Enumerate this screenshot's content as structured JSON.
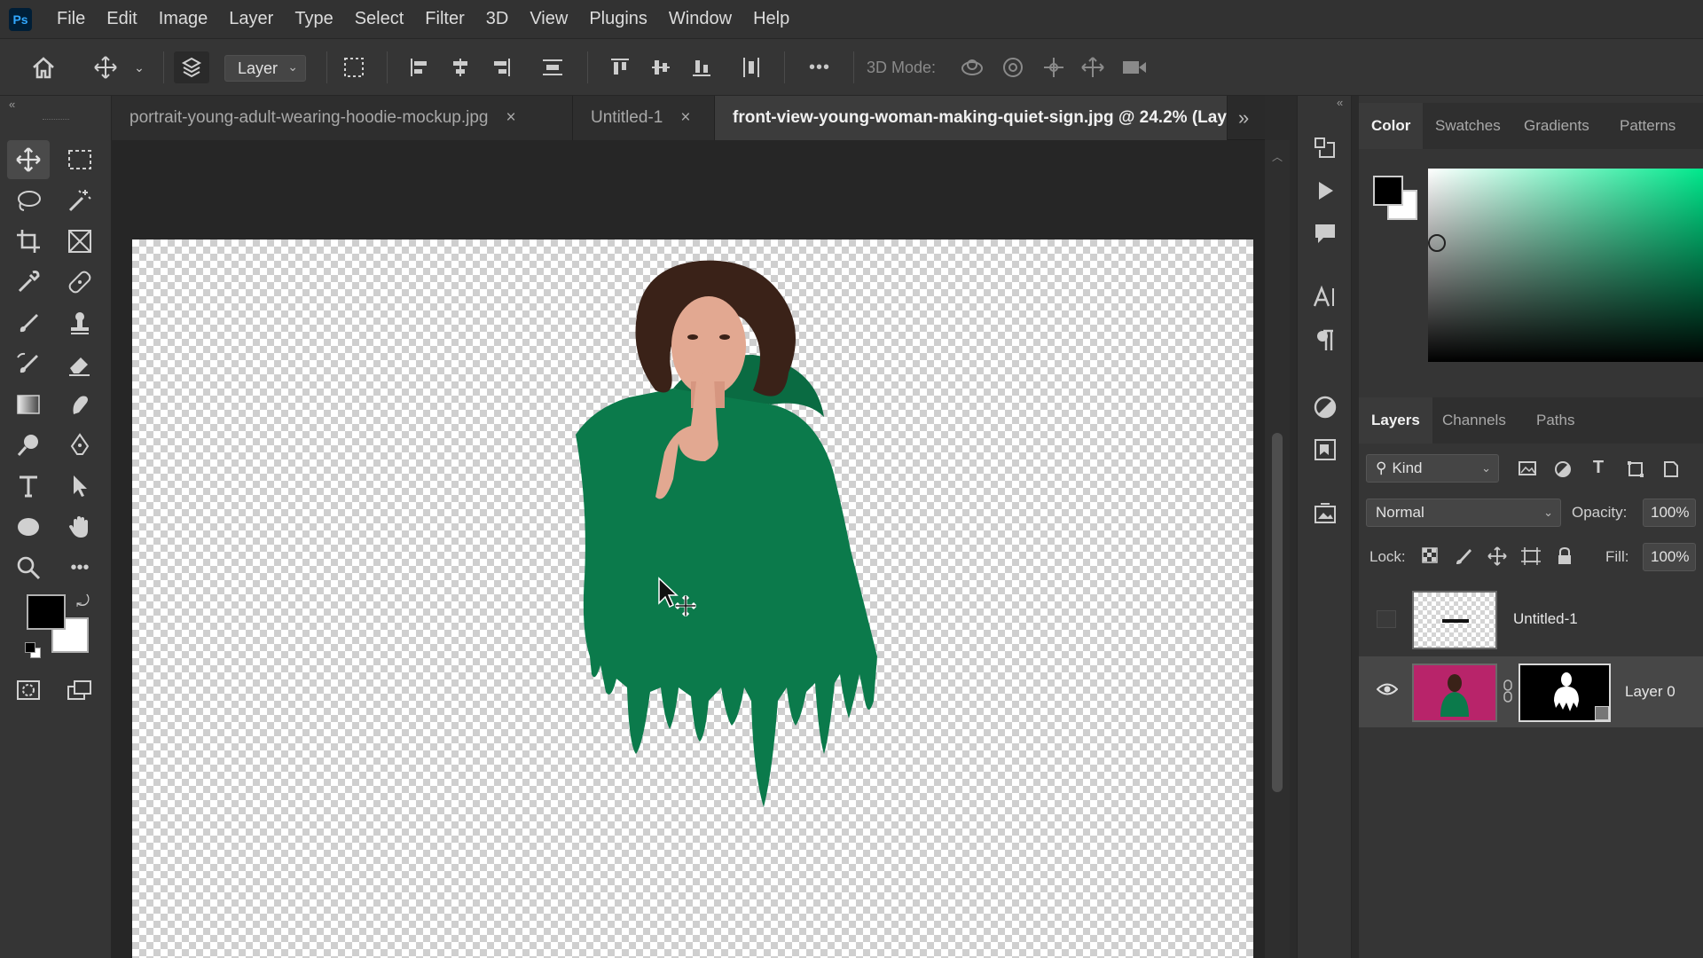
{
  "app": {
    "logo_text": "Ps"
  },
  "menu": [
    "File",
    "Edit",
    "Image",
    "Layer",
    "Type",
    "Select",
    "Filter",
    "3D",
    "View",
    "Plugins",
    "Window",
    "Help"
  ],
  "options_bar": {
    "auto_select_value": "Layer",
    "mode_3d_label": "3D Mode:",
    "more_label": "•••"
  },
  "tabs": [
    {
      "label": "portrait-young-adult-wearing-hoodie-mockup.jpg",
      "close": "×"
    },
    {
      "label": "Untitled-1",
      "close": "×"
    },
    {
      "label": "front-view-young-woman-making-quiet-sign.jpg @ 24.2% (Lay",
      "close": ""
    }
  ],
  "tabs_overflow": "»",
  "collapse_left": "«",
  "collapse_right": "«",
  "color_panel": {
    "tabs": [
      "Color",
      "Swatches",
      "Gradients",
      "Patterns"
    ],
    "active_tab": "Color",
    "foreground": "#000000",
    "background": "#ffffff",
    "hue_color": "#00e88c"
  },
  "layers_panel": {
    "tabs": [
      "Layers",
      "Channels",
      "Paths"
    ],
    "active_tab": "Layers",
    "filter_kind": "Kind",
    "blend_mode": "Normal",
    "opacity_label": "Opacity:",
    "opacity_value": "100%",
    "lock_label": "Lock:",
    "fill_label": "Fill:",
    "fill_value": "100%",
    "layers": [
      {
        "name": "Untitled-1",
        "visible": false,
        "selected": false
      },
      {
        "name": "Layer 0",
        "visible": true,
        "selected": true
      }
    ]
  },
  "colors": {
    "hoodie_green": "#0b7a4b",
    "hair": "#3a2218",
    "skin": "#e2a891"
  }
}
